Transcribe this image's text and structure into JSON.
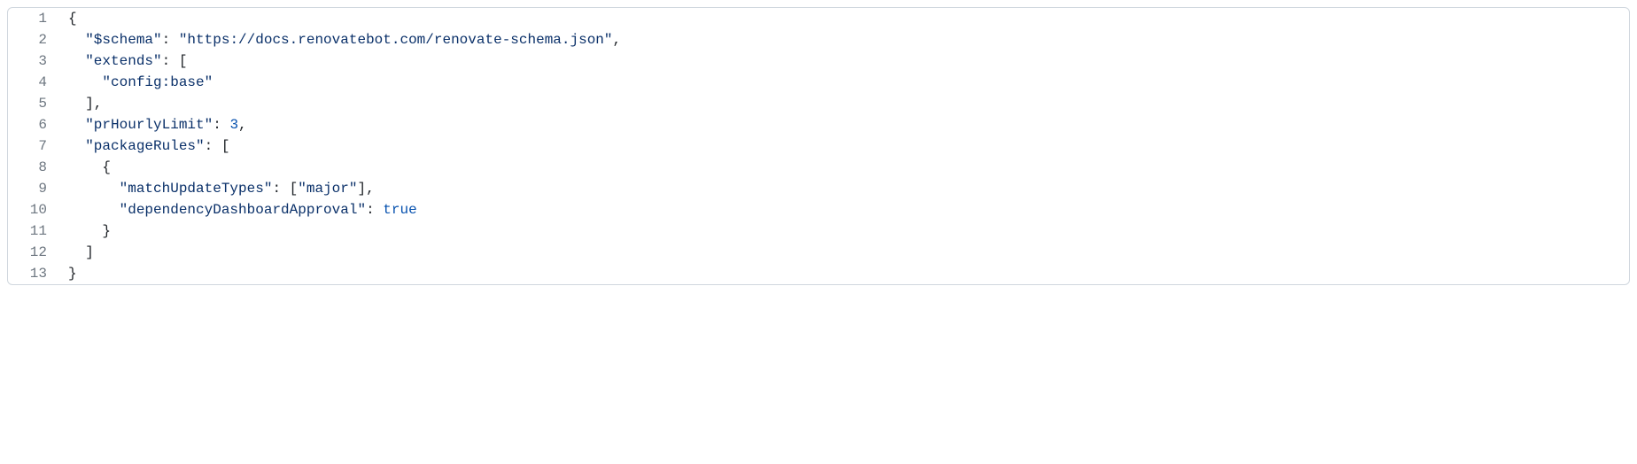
{
  "code": {
    "lines": [
      {
        "num": "1",
        "tokens": [
          {
            "text": "{",
            "cls": "tk-punct"
          }
        ]
      },
      {
        "num": "2",
        "tokens": [
          {
            "text": "  ",
            "cls": ""
          },
          {
            "text": "\"$schema\"",
            "cls": "tk-key"
          },
          {
            "text": ": ",
            "cls": "tk-punct"
          },
          {
            "text": "\"https://docs.renovatebot.com/renovate-schema.json\"",
            "cls": "tk-string"
          },
          {
            "text": ",",
            "cls": "tk-punct"
          }
        ]
      },
      {
        "num": "3",
        "tokens": [
          {
            "text": "  ",
            "cls": ""
          },
          {
            "text": "\"extends\"",
            "cls": "tk-key"
          },
          {
            "text": ": [",
            "cls": "tk-punct"
          }
        ]
      },
      {
        "num": "4",
        "tokens": [
          {
            "text": "    ",
            "cls": ""
          },
          {
            "text": "\"config:base\"",
            "cls": "tk-string"
          }
        ]
      },
      {
        "num": "5",
        "tokens": [
          {
            "text": "  ],",
            "cls": "tk-punct"
          }
        ]
      },
      {
        "num": "6",
        "tokens": [
          {
            "text": "  ",
            "cls": ""
          },
          {
            "text": "\"prHourlyLimit\"",
            "cls": "tk-key"
          },
          {
            "text": ": ",
            "cls": "tk-punct"
          },
          {
            "text": "3",
            "cls": "tk-number"
          },
          {
            "text": ",",
            "cls": "tk-punct"
          }
        ]
      },
      {
        "num": "7",
        "tokens": [
          {
            "text": "  ",
            "cls": ""
          },
          {
            "text": "\"packageRules\"",
            "cls": "tk-key"
          },
          {
            "text": ": [",
            "cls": "tk-punct"
          }
        ]
      },
      {
        "num": "8",
        "tokens": [
          {
            "text": "    {",
            "cls": "tk-punct"
          }
        ]
      },
      {
        "num": "9",
        "tokens": [
          {
            "text": "      ",
            "cls": ""
          },
          {
            "text": "\"matchUpdateTypes\"",
            "cls": "tk-key"
          },
          {
            "text": ": [",
            "cls": "tk-punct"
          },
          {
            "text": "\"major\"",
            "cls": "tk-string"
          },
          {
            "text": "],",
            "cls": "tk-punct"
          }
        ]
      },
      {
        "num": "10",
        "tokens": [
          {
            "text": "      ",
            "cls": ""
          },
          {
            "text": "\"dependencyDashboardApproval\"",
            "cls": "tk-key"
          },
          {
            "text": ": ",
            "cls": "tk-punct"
          },
          {
            "text": "true",
            "cls": "tk-bool"
          }
        ]
      },
      {
        "num": "11",
        "tokens": [
          {
            "text": "    }",
            "cls": "tk-punct"
          }
        ]
      },
      {
        "num": "12",
        "tokens": [
          {
            "text": "  ]",
            "cls": "tk-punct"
          }
        ]
      },
      {
        "num": "13",
        "tokens": [
          {
            "text": "}",
            "cls": "tk-punct"
          }
        ]
      }
    ]
  }
}
